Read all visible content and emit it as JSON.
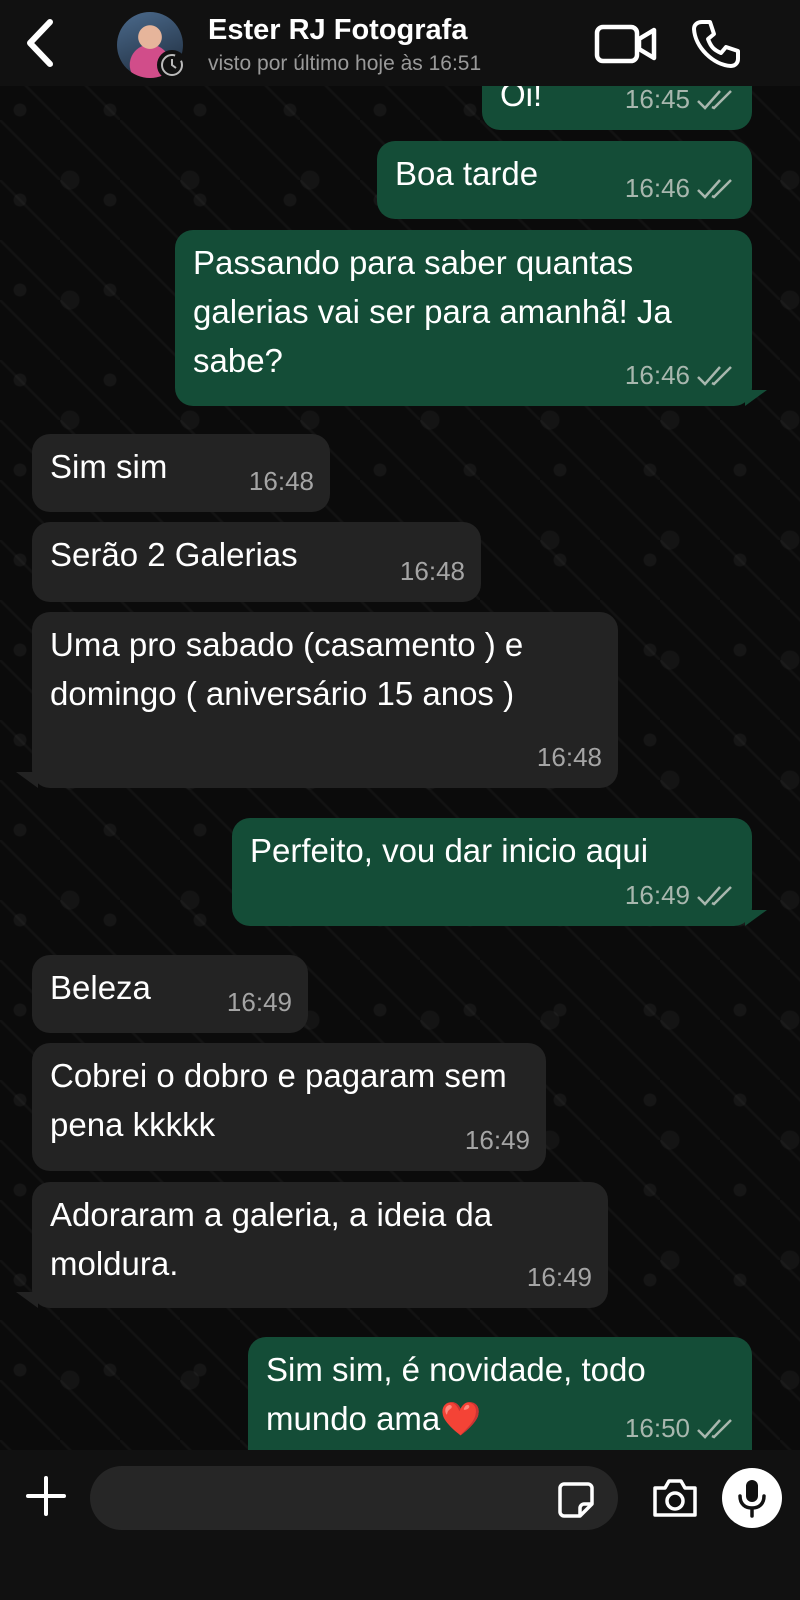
{
  "header": {
    "contact_name": "Ester RJ Fotografa",
    "last_seen": "visto por último hoje às 16:51",
    "icons": {
      "back": "chevron-left-icon",
      "avatar_status": "clock-icon",
      "video": "video-camera-icon",
      "call": "phone-icon"
    }
  },
  "messages": [
    {
      "direction": "out",
      "text": "Oi!",
      "time": "16:45",
      "ticks": "read"
    },
    {
      "direction": "out",
      "text": "Boa tarde",
      "time": "16:46",
      "ticks": "read"
    },
    {
      "direction": "out",
      "text": "Passando para saber quantas galerias vai ser para amanhã! Ja sabe?",
      "time": "16:46",
      "ticks": "read"
    },
    {
      "direction": "in",
      "text": "Sim sim",
      "time": "16:48"
    },
    {
      "direction": "in",
      "text": "Serão 2 Galerias",
      "time": "16:48"
    },
    {
      "direction": "in",
      "text": "Uma pro sabado (casamento ) e domingo ( aniversário 15 anos )",
      "time": "16:48"
    },
    {
      "direction": "out",
      "text": "Perfeito, vou dar inicio aqui",
      "time": "16:49",
      "ticks": "read"
    },
    {
      "direction": "in",
      "text": "Beleza",
      "time": "16:49"
    },
    {
      "direction": "in",
      "text": "Cobrei o dobro e pagaram sem pena kkkkk",
      "time": "16:49"
    },
    {
      "direction": "in",
      "text": "Adoraram a galeria, a ideia da moldura.",
      "time": "16:49"
    },
    {
      "direction": "out",
      "text": "Sim sim, é novidade, todo mundo ama❤️",
      "time": "16:50",
      "ticks": "read"
    }
  ],
  "composer": {
    "placeholder": "",
    "icons": {
      "plus": "plus-icon",
      "sticker": "sticker-icon",
      "camera": "camera-icon",
      "mic": "microphone-icon"
    }
  },
  "colors": {
    "outgoing_bubble": "#144d37",
    "incoming_bubble": "#232323",
    "background": "#0b0b0b",
    "read_ticks": "#a8b7ae"
  }
}
